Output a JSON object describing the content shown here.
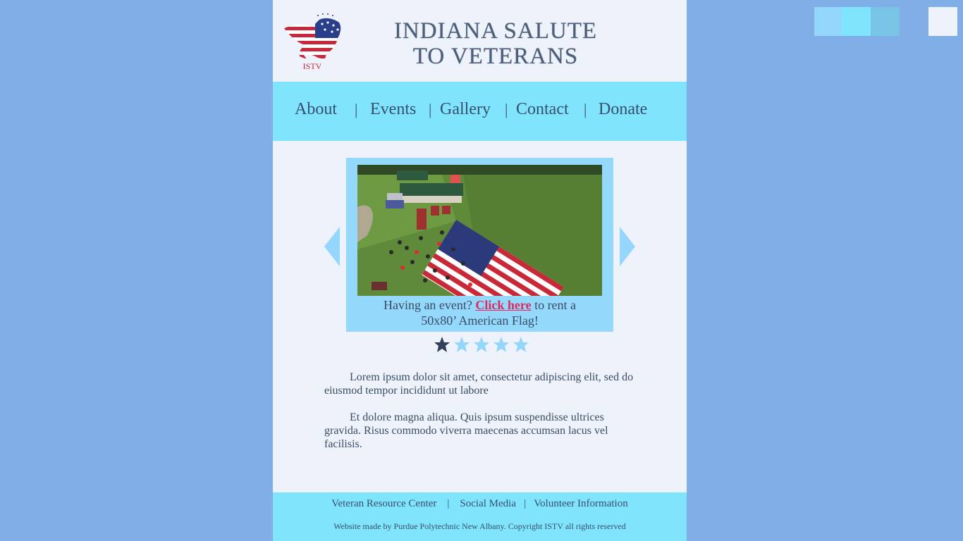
{
  "palette": {
    "swatches": [
      "#94d6fc",
      "#80e4fc",
      "#78c4e6",
      "#80aee6",
      "#eef2fa"
    ]
  },
  "header": {
    "logo_text": "ISTV",
    "title_line1": "Indiana Salute",
    "title_line2": "to Veterans"
  },
  "nav": {
    "items": [
      "About",
      "Events",
      "Gallery",
      "Contact",
      "Donate"
    ],
    "separator": "|"
  },
  "slider": {
    "caption_prefix": "Having an event? ",
    "caption_link": "Click here",
    "caption_suffix": " to rent a",
    "caption_line2": "50x80’ American Flag!",
    "slide_count": 5,
    "active_slide": 1
  },
  "content": {
    "paragraph1": "Lorem ipsum dolor sit amet, consectetur adipiscing elit, sed do eiusmod tempor incididunt ut labore",
    "paragraph2": "Et dolore magna aliqua. Quis ipsum suspendisse ultrices gravida. Risus commodo viverra maecenas accumsan lacus vel facilisis."
  },
  "footer": {
    "links": [
      "Veteran Resource Center",
      "Social Media",
      "Volunteer Information"
    ],
    "separator": "|",
    "copyright": "Website made by Purdue Polytechnic New Albany. Copyright ISTV all rights reserved"
  },
  "colors": {
    "link": "#e02a5c",
    "nav_bg": "#80e4fc",
    "page_bg": "#eef2fa",
    "body_bg": "#80aee6"
  }
}
